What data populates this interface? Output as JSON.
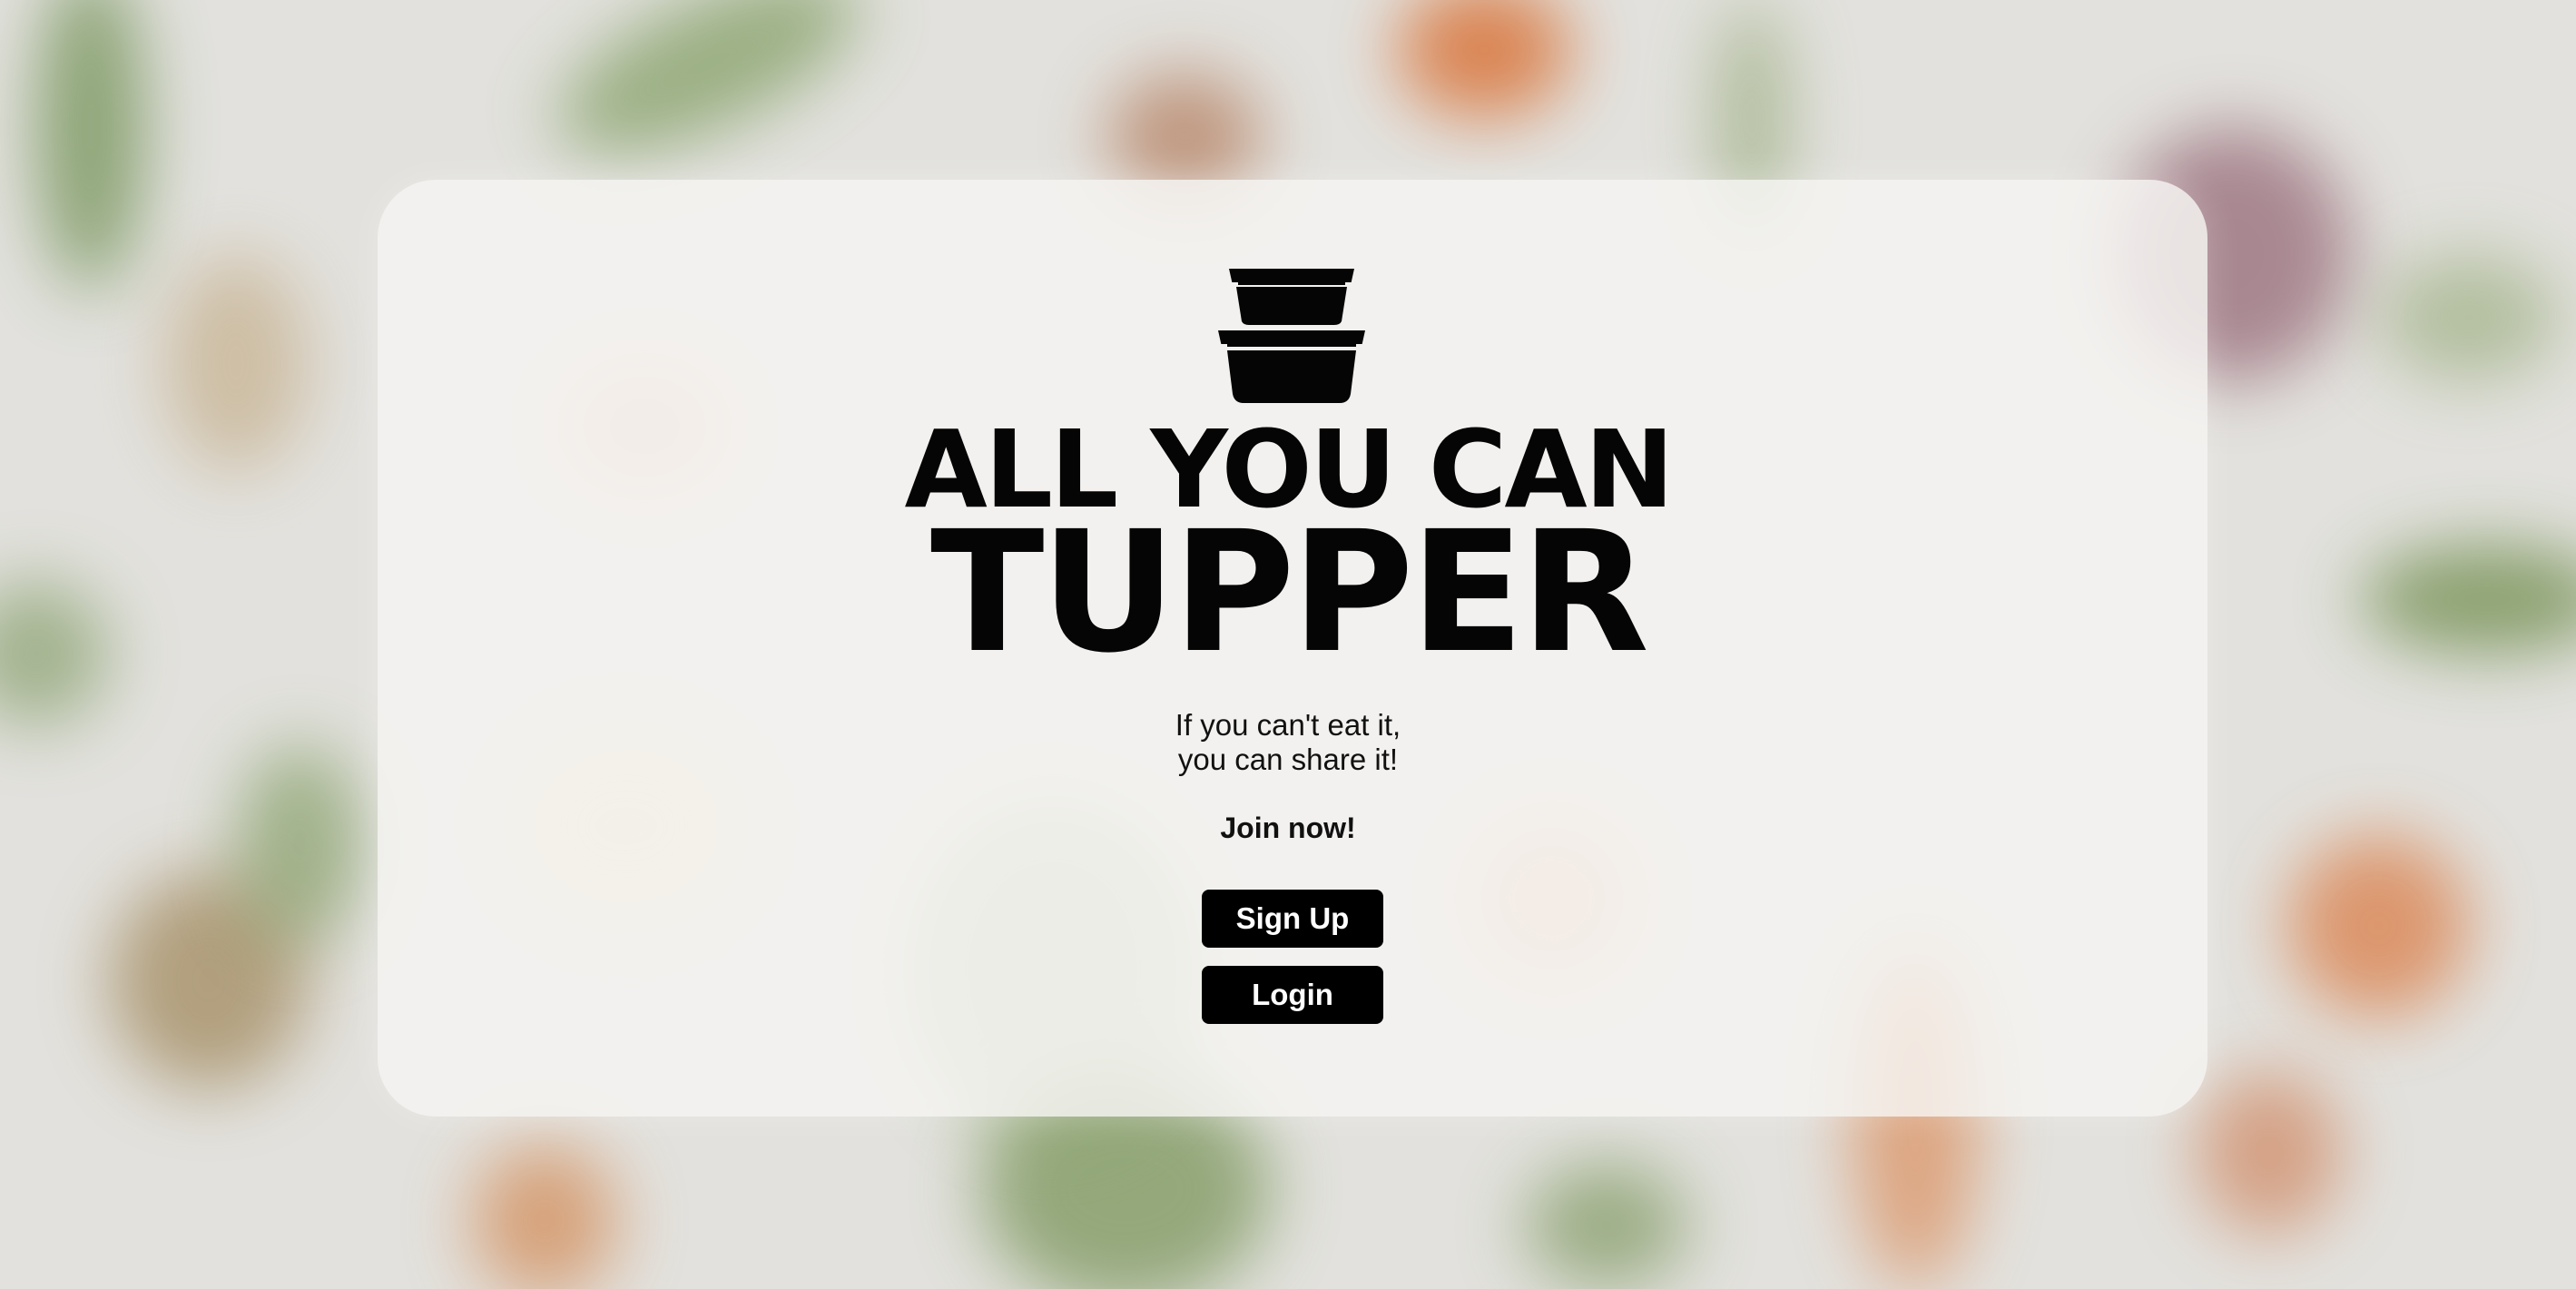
{
  "hero": {
    "logo_icon": "stacked-food-containers-icon",
    "title_line1": "ALL YOU CAN",
    "title_line2": "TUPPER",
    "tagline_line1": "If you can't eat it,",
    "tagline_line2": "you can share it!",
    "cta_text": "Join now!"
  },
  "actions": {
    "signup_label": "Sign Up",
    "login_label": "Login"
  },
  "colors": {
    "text": "#050505",
    "button_bg": "#000000",
    "button_text": "#ffffff",
    "card_bg": "rgba(245,244,242,0.84)"
  }
}
